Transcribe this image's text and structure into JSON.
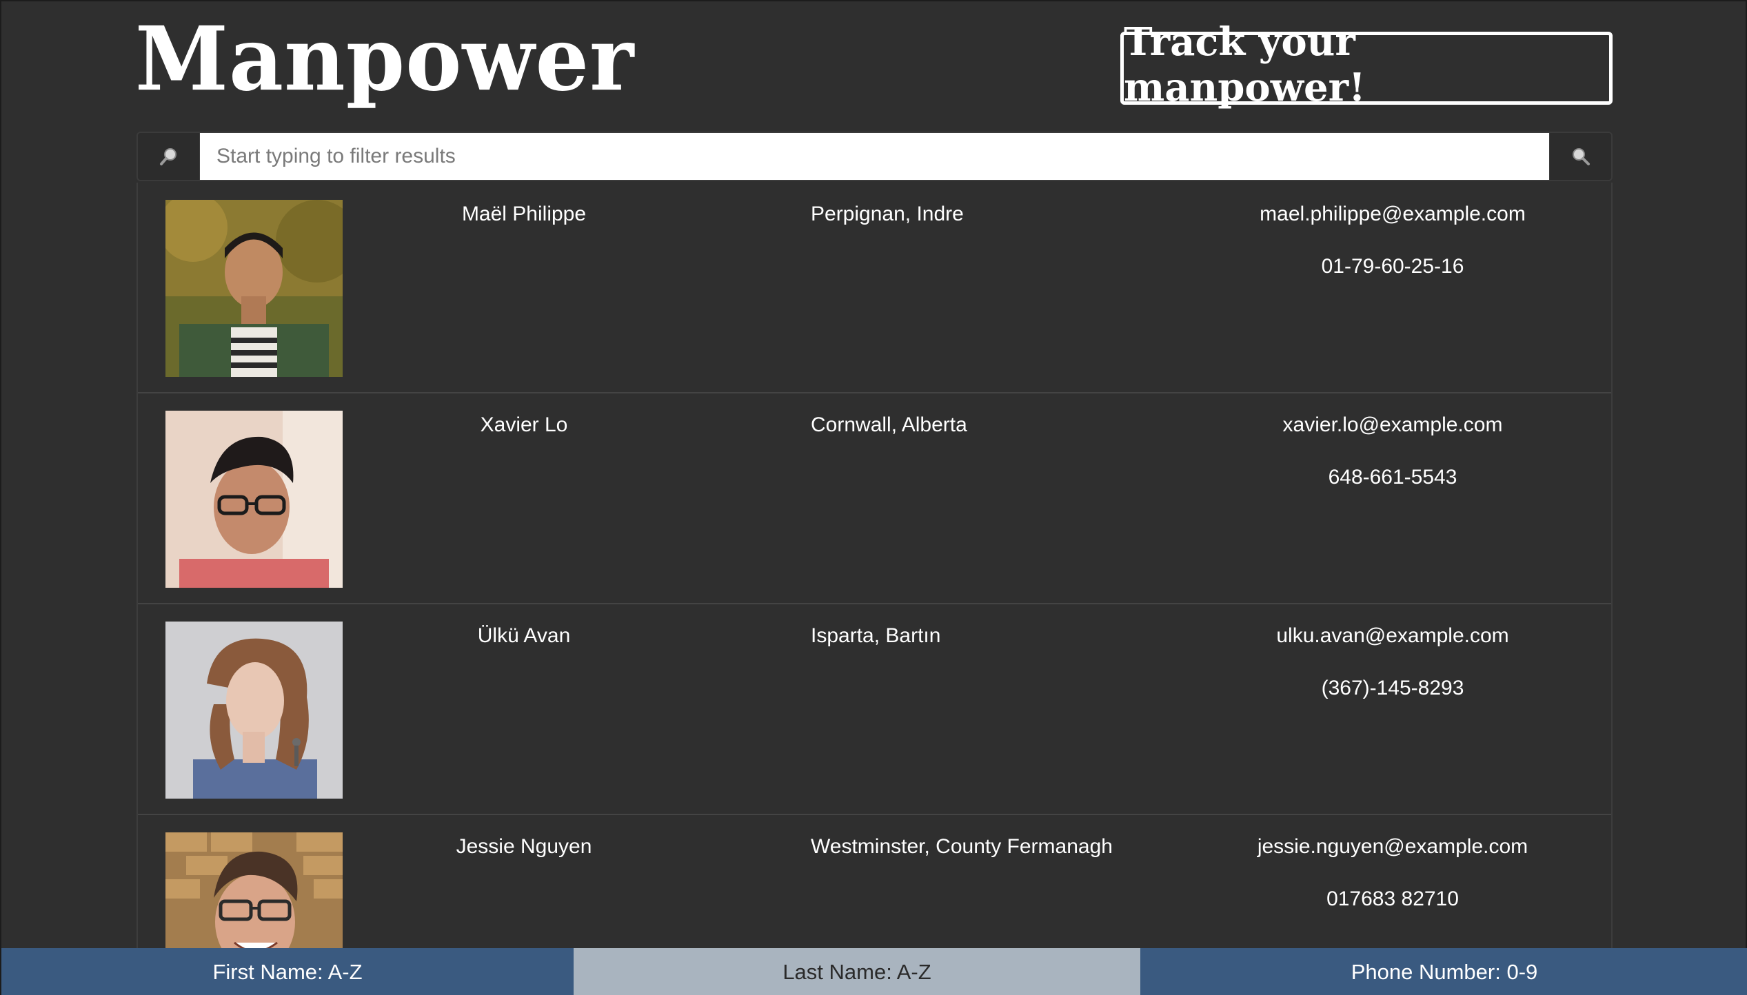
{
  "header": {
    "brand": "Manpower",
    "tagline": "Track your manpower!"
  },
  "search": {
    "placeholder": "Start typing to filter results",
    "value": "",
    "left_icon": "magnifier-icon",
    "right_icon": "magnifier-icon"
  },
  "people": [
    {
      "name": "Maël Philippe",
      "location": "Perpignan, Indre",
      "email": "mael.philippe@example.com",
      "phone": "01-79-60-25-16"
    },
    {
      "name": "Xavier Lo",
      "location": "Cornwall, Alberta",
      "email": "xavier.lo@example.com",
      "phone": "648-661-5543"
    },
    {
      "name": "Ülkü Avan",
      "location": "Isparta, Bartın",
      "email": "ulku.avan@example.com",
      "phone": "(367)-145-8293"
    },
    {
      "name": "Jessie Nguyen",
      "location": "Westminster, County Fermanagh",
      "email": "jessie.nguyen@example.com",
      "phone": "017683 82710"
    }
  ],
  "sort": {
    "first_name": "First Name: A-Z",
    "last_name": "Last Name: A-Z",
    "phone_number": "Phone Number: 0-9",
    "active": "last_name"
  },
  "colors": {
    "background": "#2f2f2f",
    "sort_active": "#a9b4bf",
    "sort_inactive": "#3a5a80"
  }
}
